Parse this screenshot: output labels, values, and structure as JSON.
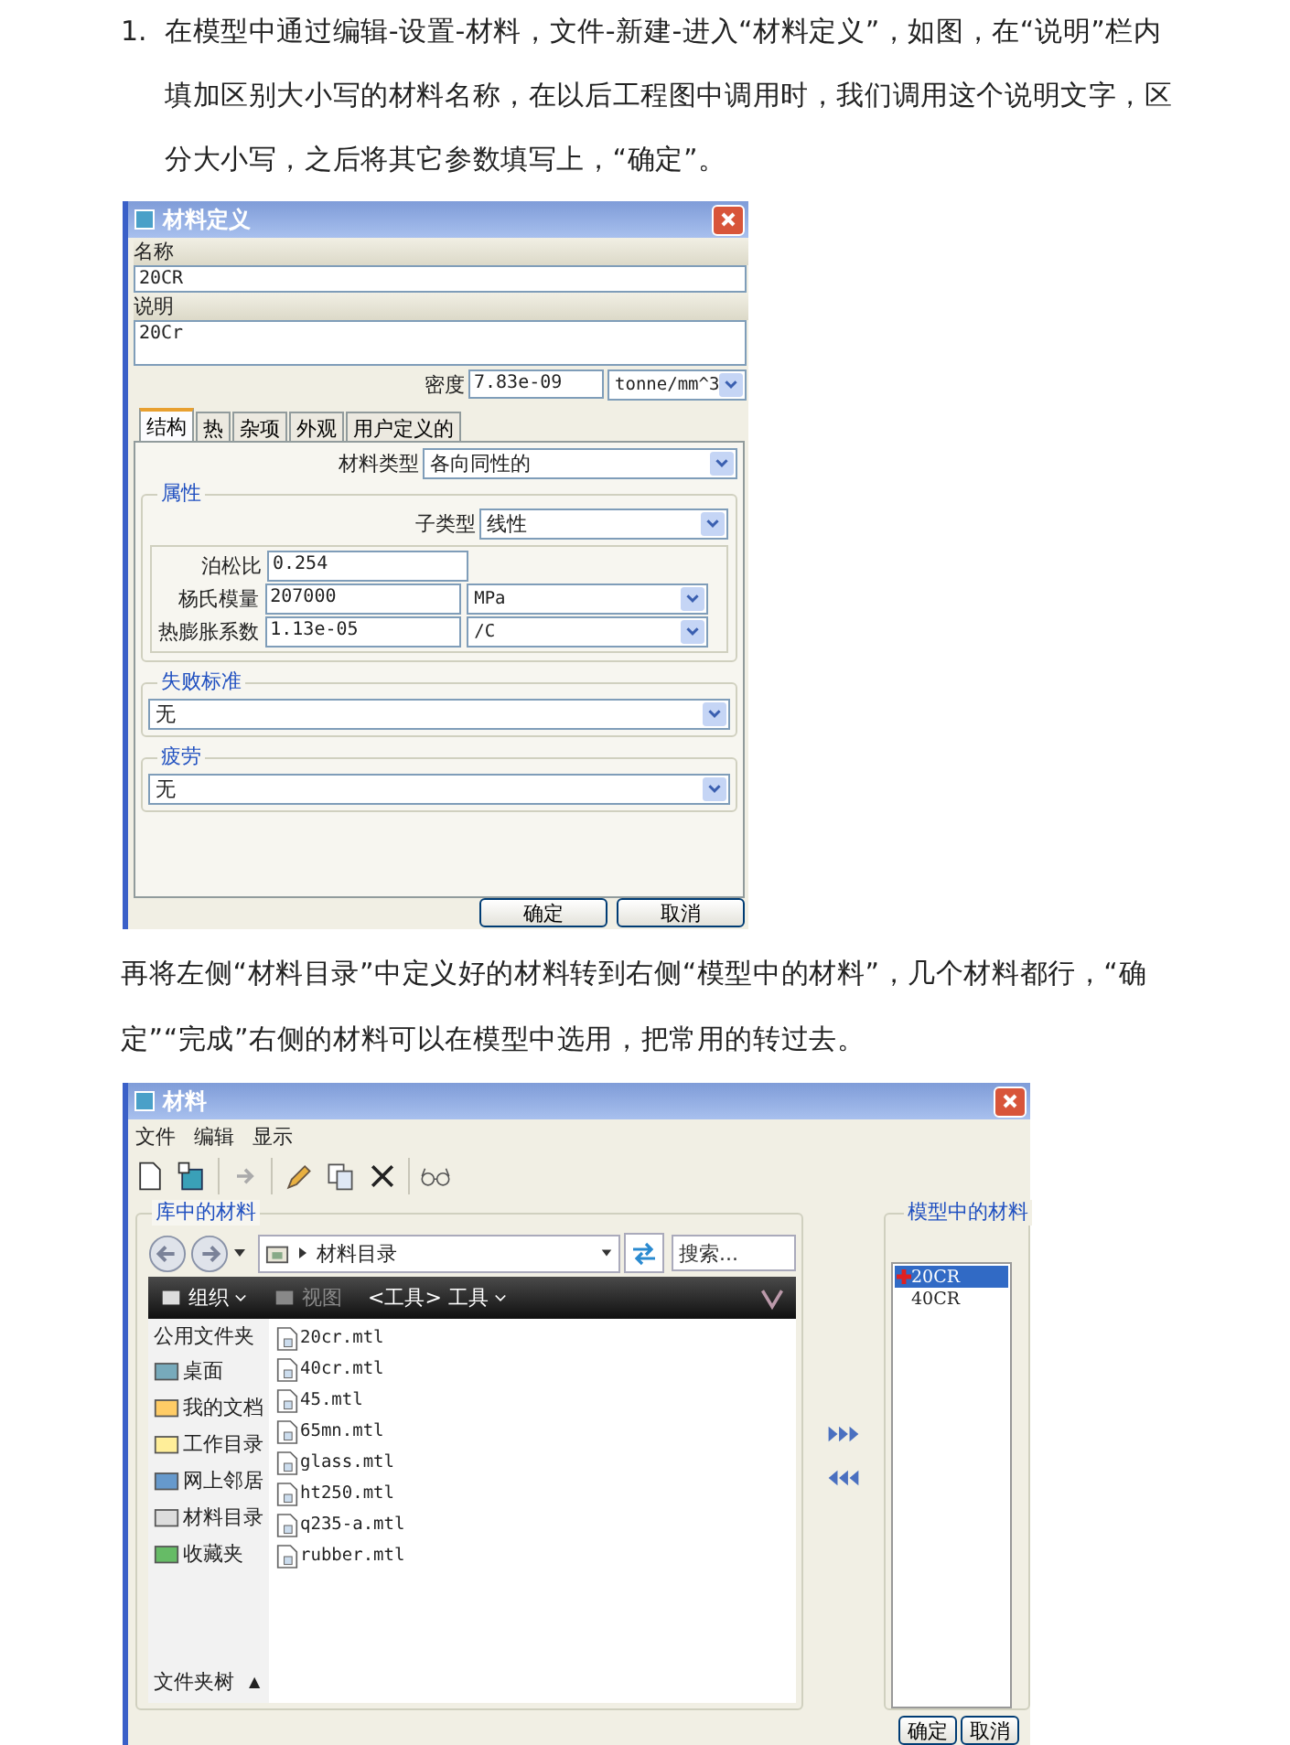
{
  "intro": {
    "number": "1.",
    "text": "在模型中通过编辑-设置-材料，文件-新建-进入“材料定义”，如图，在“说明”栏内填加区别大小写的材料名称，在以后工程图中调用时，我们调用这个说明文字，区分大小写，之后将其它参数填写上，“确定”。"
  },
  "definition_dialog": {
    "title": "材料定义",
    "name_label": "名称",
    "name_value": "20CR",
    "description_label": "说明",
    "description_value": "20Cr",
    "density_label": "密度",
    "density_value": "7.83e-09",
    "density_unit": "tonne/mm^3",
    "tabs": [
      {
        "label": "结构",
        "selected": true
      },
      {
        "label": "热",
        "selected": false
      },
      {
        "label": "杂项",
        "selected": false
      },
      {
        "label": "外观",
        "selected": false
      },
      {
        "label": "用户定义的",
        "selected": false
      }
    ],
    "material_type_label": "材料类型",
    "material_type_value": "各向同性的",
    "properties": {
      "legend": "属性",
      "subtype_label": "子类型",
      "subtype_value": "线性",
      "rows": [
        {
          "label": "泊松比",
          "value": "0.254"
        },
        {
          "label": "杨氏模量",
          "value": "207000",
          "unit": "MPa"
        },
        {
          "label": "热膨胀系数",
          "value": "1.13e-05",
          "unit": "/C"
        }
      ]
    },
    "failure": {
      "legend": "失败标准",
      "value": "无"
    },
    "fatigue": {
      "legend": "疲劳",
      "value": "无"
    },
    "buttons": [
      "确定",
      "取消"
    ]
  },
  "paragraph_2": "再将左侧“材料目录”中定义好的材料转到右侧“模型中的材料”，几个材料都行，“确定”“完成”右侧的材料可以在模型中选用，把常用的转过去。",
  "materials_dialog": {
    "title": "材料",
    "menu": [
      "文件",
      "编辑",
      "显示"
    ],
    "library": {
      "legend": "库中的材料",
      "path": "材料目录",
      "search_placeholder": "搜索...",
      "commands": [
        {
          "label": "组织",
          "disabled": false,
          "dropdown": true
        },
        {
          "label": "视图",
          "disabled": true,
          "dropdown": false
        },
        {
          "label": "<工具> 工具",
          "disabled": false,
          "dropdown": true
        }
      ],
      "sidebar_heading": "公用文件夹",
      "sidebar_items": [
        "桌面",
        "我的文档",
        "工作目录",
        "网上邻居",
        "材料目录",
        "收藏夹"
      ],
      "folder_tree": {
        "label": "文件夹树",
        "toggle": "▲"
      },
      "files": [
        "20cr.mtl",
        "40cr.mtl",
        "45.mtl",
        "65mn.mtl",
        "glass.mtl",
        "ht250.mtl",
        "q235-a.mtl",
        "rubber.mtl"
      ]
    },
    "model": {
      "legend": "模型中的材料",
      "items": [
        {
          "name": "20CR",
          "selected": true
        },
        {
          "name": "40CR",
          "selected": false
        }
      ]
    },
    "buttons": [
      "确定",
      "取消"
    ]
  }
}
